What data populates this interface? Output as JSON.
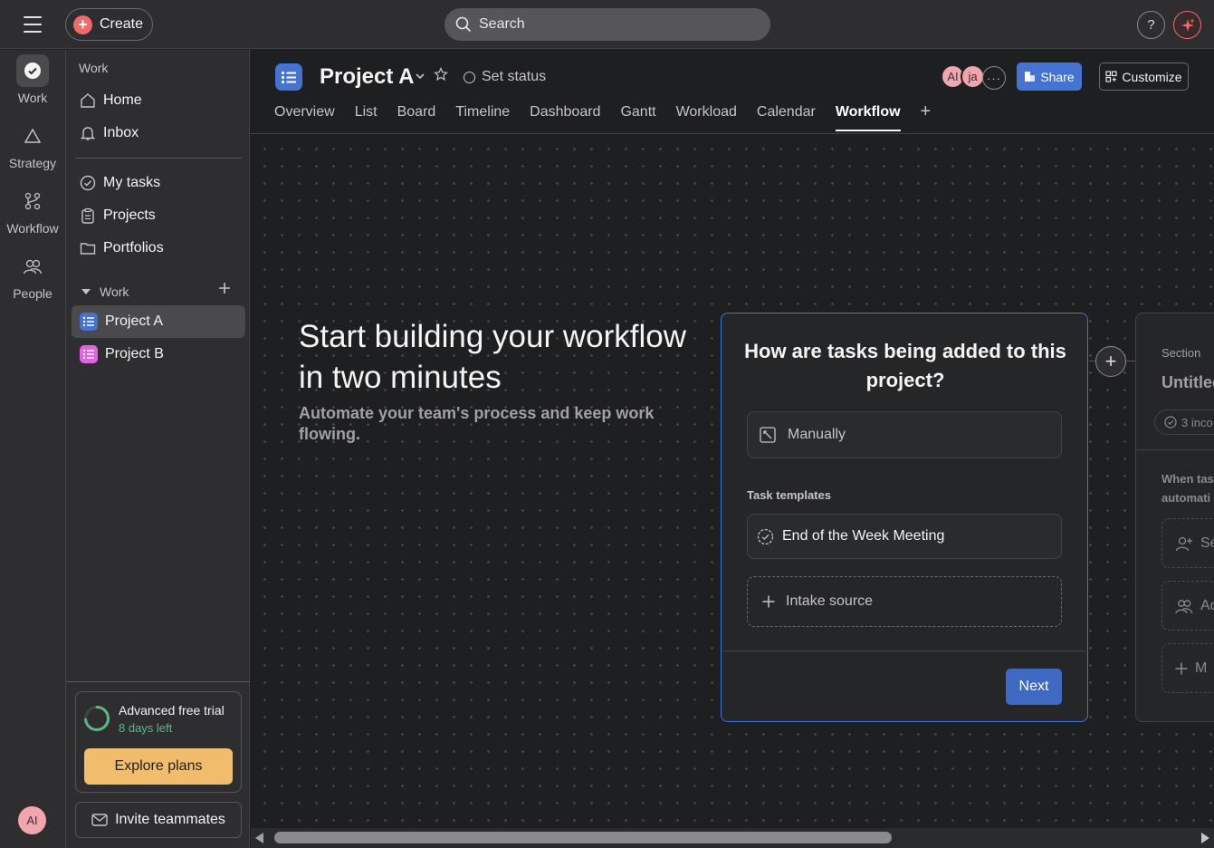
{
  "topbar": {
    "create_label": "Create",
    "search_label": "Search",
    "help_label": "?"
  },
  "rail": {
    "items": [
      {
        "label": "Work",
        "icon": "check-circle-icon"
      },
      {
        "label": "Strategy",
        "icon": "triangle-icon"
      },
      {
        "label": "Workflow",
        "icon": "workflow-icon"
      },
      {
        "label": "People",
        "icon": "people-icon"
      }
    ],
    "avatar": "AI"
  },
  "sidebar": {
    "section_work": "Work",
    "items": [
      {
        "label": "Home",
        "icon": "home-icon"
      },
      {
        "label": "Inbox",
        "icon": "bell-icon"
      },
      {
        "label": "My tasks",
        "icon": "check-circle-icon"
      },
      {
        "label": "Projects",
        "icon": "clipboard-icon"
      },
      {
        "label": "Portfolios",
        "icon": "folder-icon"
      }
    ],
    "group_label": "Work",
    "projects": [
      {
        "label": "Project A",
        "color": "#4573d2"
      },
      {
        "label": "Project B",
        "color": "#e362e3"
      }
    ],
    "trial": {
      "title": "Advanced free trial",
      "days_left": "8 days left",
      "explore_label": "Explore plans",
      "progress_fraction": 0.73
    },
    "invite_label": "Invite teammates"
  },
  "project": {
    "title": "Project A",
    "set_status": "Set status",
    "members": [
      "AI",
      "ja"
    ],
    "share_label": "Share",
    "customize_label": "Customize",
    "tabs": [
      "Overview",
      "List",
      "Board",
      "Timeline",
      "Dashboard",
      "Gantt",
      "Workload",
      "Calendar",
      "Workflow"
    ],
    "active_tab": "Workflow"
  },
  "workflow": {
    "hero_title": "Start building your workflow in two minutes",
    "hero_subtitle": "Automate your team's process and keep work flowing.",
    "question": "How are tasks being added to this project?",
    "manually_label": "Manually",
    "templates_heading": "Task templates",
    "template_item": "End of the Week Meeting",
    "intake_label": "Intake source",
    "next_label": "Next",
    "section_card": {
      "label": "Section",
      "title": "Untitled",
      "pill": "3 inco",
      "text_line1": "When tas",
      "text_line2": "automati",
      "slot1": "Se",
      "slot2": "Ad",
      "slot3": "M"
    }
  },
  "colors": {
    "accent": "#4573d2",
    "create": "#f06a6a",
    "trial_button": "#f1bd6c",
    "trial_text": "#5cb587"
  }
}
